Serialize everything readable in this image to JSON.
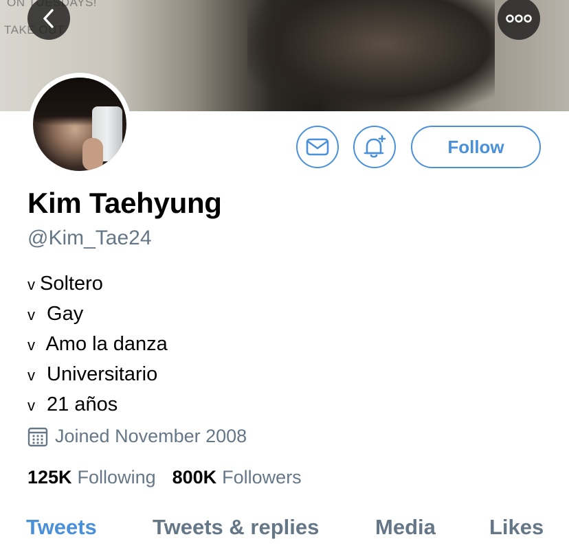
{
  "banner": {
    "bg_text_top": "ON TUESDAYS!",
    "bg_text": "TAKE OUT"
  },
  "nav": {
    "back_icon": "chevron-left-icon",
    "more_icon": "more-dots-icon"
  },
  "actions": {
    "message_icon": "mail-icon",
    "notify_icon": "bell-plus-icon",
    "follow_label": "Follow"
  },
  "profile": {
    "name": "Kim Taehyung",
    "handle": "@Kim_Tae24",
    "bio": [
      {
        "mark": "v",
        "text": "Soltero"
      },
      {
        "mark": "v",
        "text": " Gay"
      },
      {
        "mark": "v",
        "text": " Amo la danza"
      },
      {
        "mark": "v",
        "text": " Universitario"
      },
      {
        "mark": "v",
        "text": " 21 años"
      }
    ],
    "joined": "Joined November 2008"
  },
  "stats": {
    "following_count": "125K",
    "following_label": "Following",
    "followers_count": "800K",
    "followers_label": "Followers"
  },
  "tabs": [
    {
      "label": "Tweets",
      "active": true
    },
    {
      "label": "Tweets & replies",
      "active": false
    },
    {
      "label": "Media",
      "active": false
    },
    {
      "label": "Likes",
      "active": false
    }
  ],
  "colors": {
    "accent": "#4a90d9",
    "secondary_text": "#657786"
  }
}
